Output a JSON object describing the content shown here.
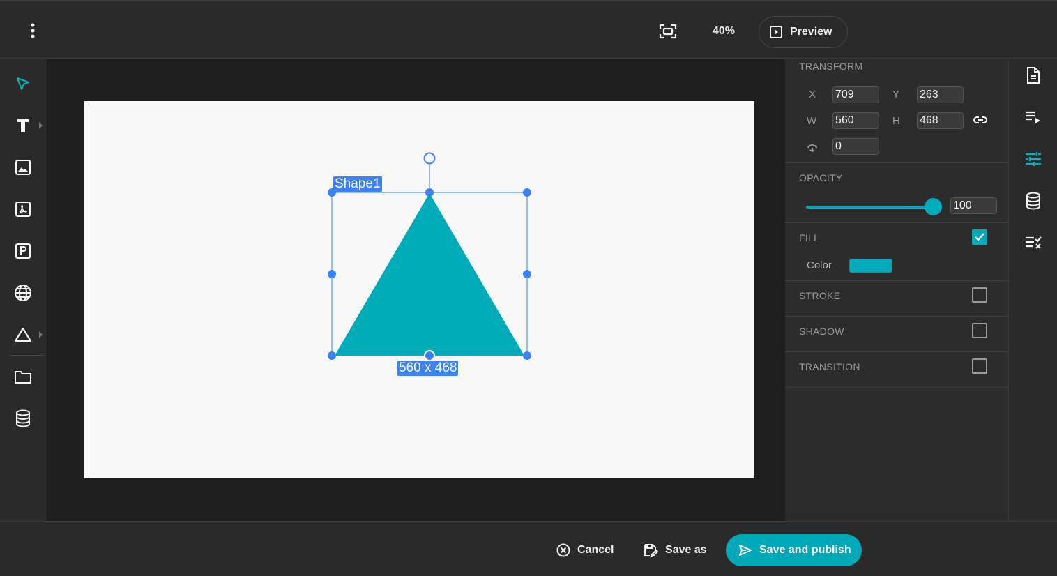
{
  "topbar": {
    "menu_icon": "kebab-vertical-icon",
    "fit_icon": "fit-screen-icon",
    "zoom": "40%",
    "preview_label": "Preview"
  },
  "left_tools": [
    {
      "name": "select",
      "icon": "pointer-arrow-icon",
      "active": true
    },
    {
      "name": "text",
      "icon": "text-t-icon",
      "has_submenu": true
    },
    {
      "name": "image",
      "icon": "image-icon"
    },
    {
      "name": "pdf",
      "icon": "pdf-icon"
    },
    {
      "name": "parking",
      "icon": "p-box-icon"
    },
    {
      "name": "web",
      "icon": "globe-icon"
    },
    {
      "name": "shape",
      "icon": "triangle-icon",
      "has_submenu": true
    },
    {
      "name": "folder",
      "icon": "folder-icon"
    },
    {
      "name": "database",
      "icon": "database-icon"
    }
  ],
  "canvas": {
    "shape_name": "Shape1",
    "size_label": "560 x 468",
    "shape_color": "#00abb8"
  },
  "panel": {
    "transform": {
      "title": "TRANSFORM",
      "x_label": "X",
      "x": "709",
      "y_label": "Y",
      "y": "263",
      "w_label": "W",
      "w": "560",
      "h_label": "H",
      "h": "468",
      "rotation": "0"
    },
    "opacity": {
      "title": "OPACITY",
      "value": "100",
      "level_percent": 100
    },
    "fill": {
      "title": "FILL",
      "checked": true,
      "color_label": "Color",
      "color": "#00aabb"
    },
    "stroke": {
      "title": "STROKE",
      "checked": false
    },
    "shadow": {
      "title": "SHADOW",
      "checked": false
    },
    "transition": {
      "title": "TRANSITION",
      "checked": false
    }
  },
  "rail": [
    {
      "icon": "document-icon"
    },
    {
      "icon": "playlist-icon"
    },
    {
      "icon": "sliders-icon",
      "active": true
    },
    {
      "icon": "database-icon"
    },
    {
      "icon": "list-check-icon"
    }
  ],
  "bottombar": {
    "cancel_label": "Cancel",
    "save_as_label": "Save as",
    "publish_label": "Save and publish"
  },
  "colors": {
    "accent": "#00aabb",
    "selection": "#3b82f6"
  }
}
